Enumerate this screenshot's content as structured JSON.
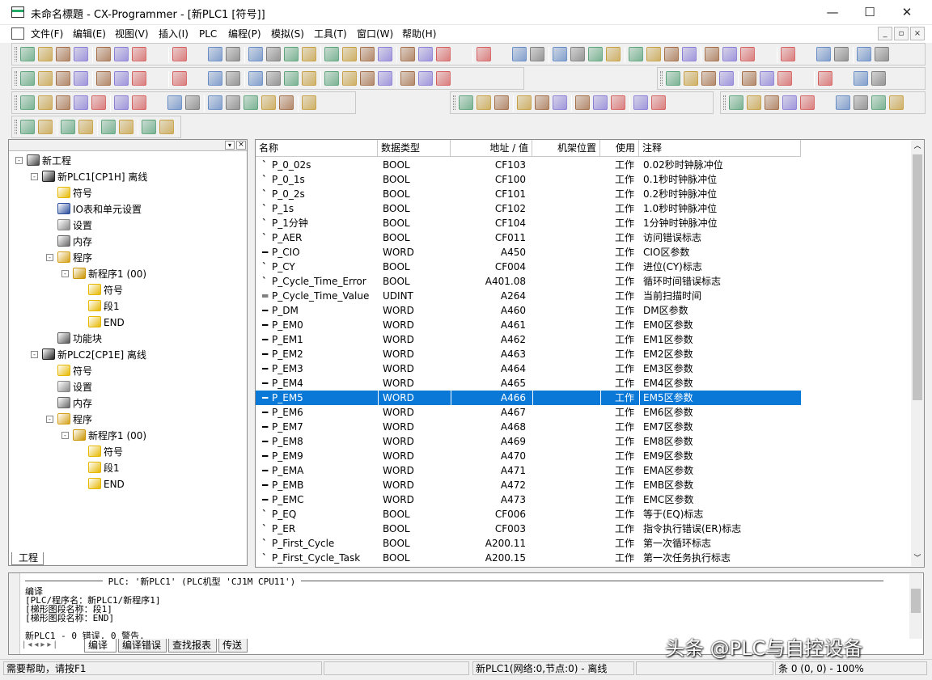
{
  "window": {
    "title": "未命名標題 - CX-Programmer - [新PLC1 [符号]]",
    "min_glyph": "—",
    "max_glyph": "☐",
    "close_glyph": "✕"
  },
  "menu": {
    "items": [
      "文件(F)",
      "编辑(E)",
      "视图(V)",
      "插入(I)",
      "PLC",
      "编程(P)",
      "模拟(S)",
      "工具(T)",
      "窗口(W)",
      "帮助(H)"
    ],
    "mdi": [
      "_",
      "▫",
      "×"
    ]
  },
  "tree": {
    "tab_label": "工程",
    "nodes": [
      {
        "label": "新工程",
        "icon": "project-icon"
      },
      {
        "label": "新PLC1[CP1H] 离线",
        "icon": "plc-icon"
      },
      {
        "label": "符号",
        "icon": "symbols-icon"
      },
      {
        "label": "IO表和单元设置",
        "icon": "io-table-icon"
      },
      {
        "label": "设置",
        "icon": "settings-icon"
      },
      {
        "label": "内存",
        "icon": "memory-icon"
      },
      {
        "label": "程序",
        "icon": "programs-icon"
      },
      {
        "label": "新程序1 (00)",
        "icon": "program-icon"
      },
      {
        "label": "符号",
        "icon": "symbols-icon"
      },
      {
        "label": "段1",
        "icon": "section-icon"
      },
      {
        "label": "END",
        "icon": "section-icon"
      },
      {
        "label": "功能块",
        "icon": "function-block-icon"
      },
      {
        "label": "新PLC2[CP1E] 离线",
        "icon": "plc-icon"
      },
      {
        "label": "符号",
        "icon": "symbols-icon"
      },
      {
        "label": "设置",
        "icon": "settings-icon"
      },
      {
        "label": "内存",
        "icon": "memory-icon"
      },
      {
        "label": "程序",
        "icon": "programs-icon"
      },
      {
        "label": "新程序1 (00)",
        "icon": "program-icon"
      },
      {
        "label": "符号",
        "icon": "symbols-icon"
      },
      {
        "label": "段1",
        "icon": "section-icon"
      },
      {
        "label": "END",
        "icon": "section-icon"
      }
    ]
  },
  "table": {
    "headers": [
      "名称",
      "数据类型",
      "地址 / 值",
      "机架位置",
      "使用",
      "注释"
    ],
    "rows": [
      {
        "mark": "`",
        "name": "P_0_02s",
        "type": "BOOL",
        "addr": "CF103",
        "use": "工作",
        "comment": "0.02秒时钟脉冲位"
      },
      {
        "mark": "`",
        "name": "P_0_1s",
        "type": "BOOL",
        "addr": "CF100",
        "use": "工作",
        "comment": "0.1秒时钟脉冲位"
      },
      {
        "mark": "`",
        "name": "P_0_2s",
        "type": "BOOL",
        "addr": "CF101",
        "use": "工作",
        "comment": "0.2秒时钟脉冲位"
      },
      {
        "mark": "`",
        "name": "P_1s",
        "type": "BOOL",
        "addr": "CF102",
        "use": "工作",
        "comment": "1.0秒时钟脉冲位"
      },
      {
        "mark": "`",
        "name": "P_1分钟",
        "type": "BOOL",
        "addr": "CF104",
        "use": "工作",
        "comment": "1分钟时钟脉冲位"
      },
      {
        "mark": "`",
        "name": "P_AER",
        "type": "BOOL",
        "addr": "CF011",
        "use": "工作",
        "comment": "访问错误标志"
      },
      {
        "mark": "━",
        "name": "P_CIO",
        "type": "WORD",
        "addr": "A450",
        "use": "工作",
        "comment": "CIO区参数"
      },
      {
        "mark": "`",
        "name": "P_CY",
        "type": "BOOL",
        "addr": "CF004",
        "use": "工作",
        "comment": "进位(CY)标志"
      },
      {
        "mark": "`",
        "name": "P_Cycle_Time_Error",
        "type": "BOOL",
        "addr": "A401.08",
        "use": "工作",
        "comment": "循环时间错误标志"
      },
      {
        "mark": "═",
        "name": "P_Cycle_Time_Value",
        "type": "UDINT",
        "addr": "A264",
        "use": "工作",
        "comment": "当前扫描时间"
      },
      {
        "mark": "━",
        "name": "P_DM",
        "type": "WORD",
        "addr": "A460",
        "use": "工作",
        "comment": "DM区参数"
      },
      {
        "mark": "━",
        "name": "P_EM0",
        "type": "WORD",
        "addr": "A461",
        "use": "工作",
        "comment": "EM0区参数"
      },
      {
        "mark": "━",
        "name": "P_EM1",
        "type": "WORD",
        "addr": "A462",
        "use": "工作",
        "comment": "EM1区参数"
      },
      {
        "mark": "━",
        "name": "P_EM2",
        "type": "WORD",
        "addr": "A463",
        "use": "工作",
        "comment": "EM2区参数"
      },
      {
        "mark": "━",
        "name": "P_EM3",
        "type": "WORD",
        "addr": "A464",
        "use": "工作",
        "comment": "EM3区参数"
      },
      {
        "mark": "━",
        "name": "P_EM4",
        "type": "WORD",
        "addr": "A465",
        "use": "工作",
        "comment": "EM4区参数"
      },
      {
        "mark": "━",
        "name": "P_EM5",
        "type": "WORD",
        "addr": "A466",
        "use": "工作",
        "comment": "EM5区参数",
        "selected": true
      },
      {
        "mark": "━",
        "name": "P_EM6",
        "type": "WORD",
        "addr": "A467",
        "use": "工作",
        "comment": "EM6区参数"
      },
      {
        "mark": "━",
        "name": "P_EM7",
        "type": "WORD",
        "addr": "A468",
        "use": "工作",
        "comment": "EM7区参数"
      },
      {
        "mark": "━",
        "name": "P_EM8",
        "type": "WORD",
        "addr": "A469",
        "use": "工作",
        "comment": "EM8区参数"
      },
      {
        "mark": "━",
        "name": "P_EM9",
        "type": "WORD",
        "addr": "A470",
        "use": "工作",
        "comment": "EM9区参数"
      },
      {
        "mark": "━",
        "name": "P_EMA",
        "type": "WORD",
        "addr": "A471",
        "use": "工作",
        "comment": "EMA区参数"
      },
      {
        "mark": "━",
        "name": "P_EMB",
        "type": "WORD",
        "addr": "A472",
        "use": "工作",
        "comment": "EMB区参数"
      },
      {
        "mark": "━",
        "name": "P_EMC",
        "type": "WORD",
        "addr": "A473",
        "use": "工作",
        "comment": "EMC区参数"
      },
      {
        "mark": "`",
        "name": "P_EQ",
        "type": "BOOL",
        "addr": "CF006",
        "use": "工作",
        "comment": "等于(EQ)标志"
      },
      {
        "mark": "`",
        "name": "P_ER",
        "type": "BOOL",
        "addr": "CF003",
        "use": "工作",
        "comment": "指令执行错误(ER)标志"
      },
      {
        "mark": "`",
        "name": "P_First_Cycle",
        "type": "BOOL",
        "addr": "A200.11",
        "use": "工作",
        "comment": "第一次循环标志"
      },
      {
        "mark": "`",
        "name": "P_First_Cycle_Task",
        "type": "BOOL",
        "addr": "A200.15",
        "use": "工作",
        "comment": "第一次任务执行标志"
      }
    ]
  },
  "output": {
    "header": "PLC: '新PLC1' (PLC机型 'CJ1M CPU11')",
    "lines": [
      "编译",
      "[PLC/程序名：新PLC1/新程序1]",
      "[梯形图段名称：段1]",
      "[梯形图段名称：END]",
      "",
      "新PLC1 - 0 错误, 0 警告."
    ],
    "tabs": [
      "编译",
      "编译错误",
      "查找报表",
      "传送"
    ]
  },
  "status": {
    "help": "需要帮助，请按F1",
    "plc_state": "新PLC1(网络:0,节点:0) - 离线",
    "position": "条 0 (0, 0)  - 100%"
  },
  "watermark": "头条 @PLC与自控设备"
}
